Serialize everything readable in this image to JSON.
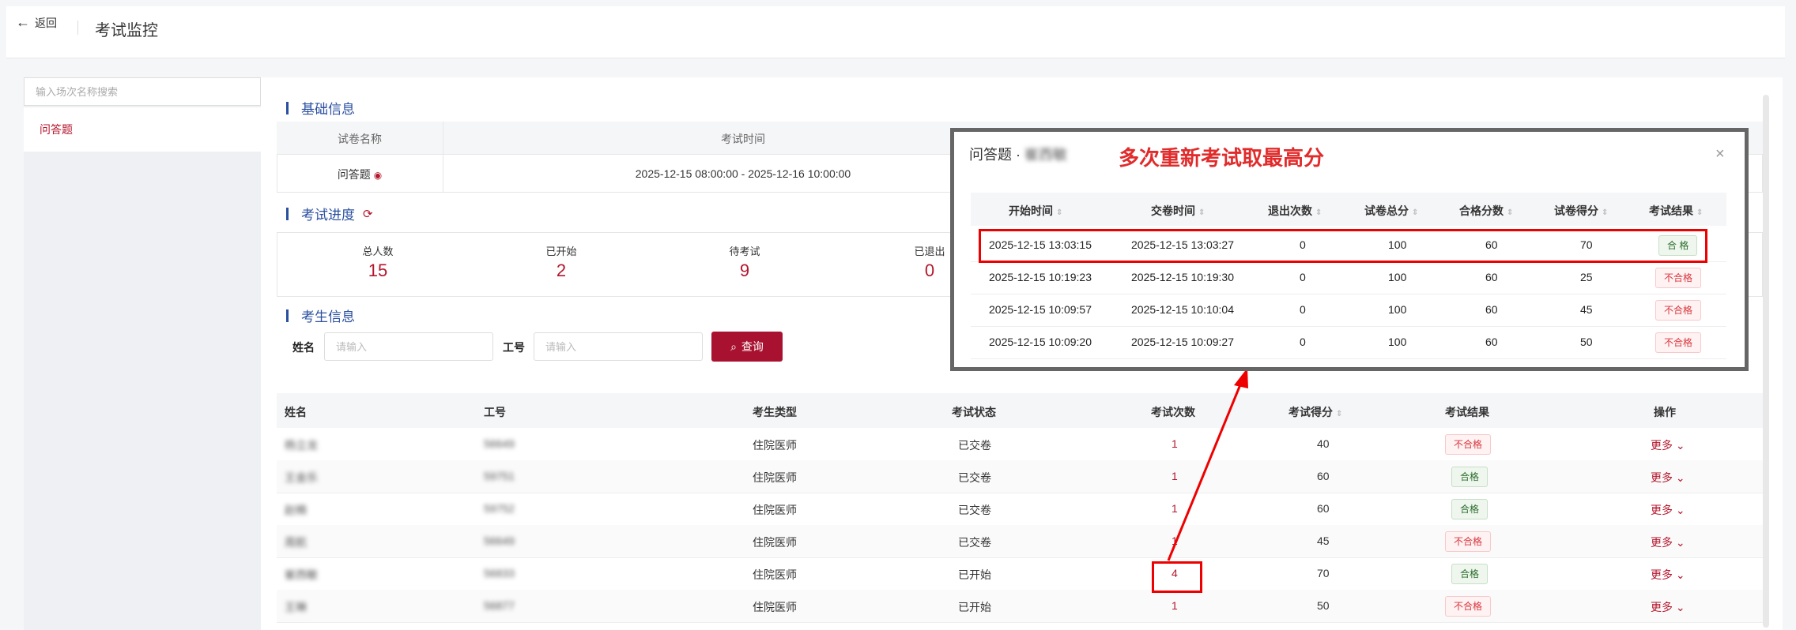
{
  "header": {
    "back_label": "返回",
    "title": "考试监控"
  },
  "left": {
    "search_placeholder": "输入场次名称搜索",
    "items": [
      "问答题"
    ]
  },
  "basic_info": {
    "title": "基础信息",
    "headers": [
      "试卷名称",
      "考试时间"
    ],
    "paper_name": "问答题",
    "exam_time": "2025-12-15 08:00:00 - 2025-12-16 10:00:00"
  },
  "progress": {
    "title": "考试进度",
    "stats": [
      {
        "label": "总人数",
        "value": "15"
      },
      {
        "label": "已开始",
        "value": "2"
      },
      {
        "label": "待考试",
        "value": "9"
      },
      {
        "label": "已退出",
        "value": "0"
      }
    ]
  },
  "candidates": {
    "title": "考生信息",
    "name_label": "姓名",
    "id_label": "工号",
    "placeholder": "请输入",
    "query_label": "查询",
    "headers": [
      "姓名",
      "工号",
      "考生类型",
      "考试状态",
      "考试次数",
      "考试得分",
      "考试结果",
      "操作"
    ],
    "rows": [
      {
        "name": "杨立龙",
        "id": "56649",
        "type": "住院医师",
        "status": "已交卷",
        "count": "1",
        "score": "40",
        "result": "不合格",
        "action": "更多"
      },
      {
        "name": "王金乐",
        "id": "59751",
        "type": "住院医师",
        "status": "已交卷",
        "count": "1",
        "score": "60",
        "result": "合格",
        "action": "更多"
      },
      {
        "name": "赵楠",
        "id": "59752",
        "type": "住院医师",
        "status": "已交卷",
        "count": "1",
        "score": "60",
        "result": "合格",
        "action": "更多"
      },
      {
        "name": "周航",
        "id": "56649",
        "type": "住院医师",
        "status": "已交卷",
        "count": "1",
        "score": "45",
        "result": "不合格",
        "action": "更多"
      },
      {
        "name": "崔西敏",
        "id": "56833",
        "type": "住院医师",
        "status": "已开始",
        "count": "4",
        "score": "70",
        "result": "合格",
        "action": "更多"
      },
      {
        "name": "王琳",
        "id": "56877",
        "type": "住院医师",
        "status": "已开始",
        "count": "1",
        "score": "50",
        "result": "不合格",
        "action": "更多"
      }
    ]
  },
  "modal": {
    "title": "问答题 · ",
    "blurred_name": "崔西敏",
    "annotation": "多次重新考试取最高分",
    "headers": [
      "开始时间",
      "交卷时间",
      "退出次数",
      "试卷总分",
      "合格分数",
      "试卷得分",
      "考试结果"
    ],
    "rows": [
      {
        "start": "2025-12-15 13:03:15",
        "end": "2025-12-15 13:03:27",
        "exits": "0",
        "total": "100",
        "pass": "60",
        "score": "70",
        "result": "合 格"
      },
      {
        "start": "2025-12-15 10:19:23",
        "end": "2025-12-15 10:19:30",
        "exits": "0",
        "total": "100",
        "pass": "60",
        "score": "25",
        "result": "不合格"
      },
      {
        "start": "2025-12-15 10:09:57",
        "end": "2025-12-15 10:10:04",
        "exits": "0",
        "total": "100",
        "pass": "60",
        "score": "45",
        "result": "不合格"
      },
      {
        "start": "2025-12-15 10:09:20",
        "end": "2025-12-15 10:09:27",
        "exits": "0",
        "total": "100",
        "pass": "60",
        "score": "50",
        "result": "不合格"
      }
    ]
  },
  "colors": {
    "accent": "#b4162c",
    "section": "#2a4fa0",
    "annotation": "#e12b2b"
  }
}
